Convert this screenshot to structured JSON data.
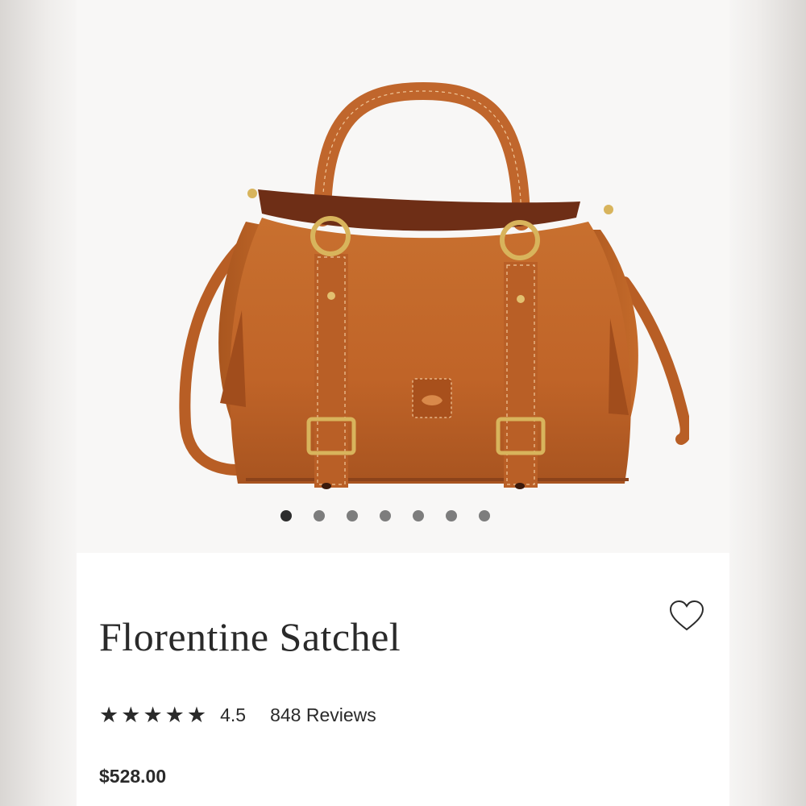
{
  "gallery": {
    "image_alt": "Florentine Satchel",
    "slide_count": 7,
    "active_slide": 1
  },
  "product": {
    "title": "Florentine Satchel",
    "rating_value": "4.5",
    "rating_numeric": 4.5,
    "rating_max": 5,
    "reviews_label": "848 Reviews",
    "price": "$528.00"
  },
  "icons": {
    "wishlist": "heart-outline-icon",
    "star": "star-icon"
  },
  "colors": {
    "leather": "#c0662c",
    "text": "#2a2a2a",
    "dot_active": "#2d2d2d",
    "dot_inactive": "#7d7d7d"
  }
}
